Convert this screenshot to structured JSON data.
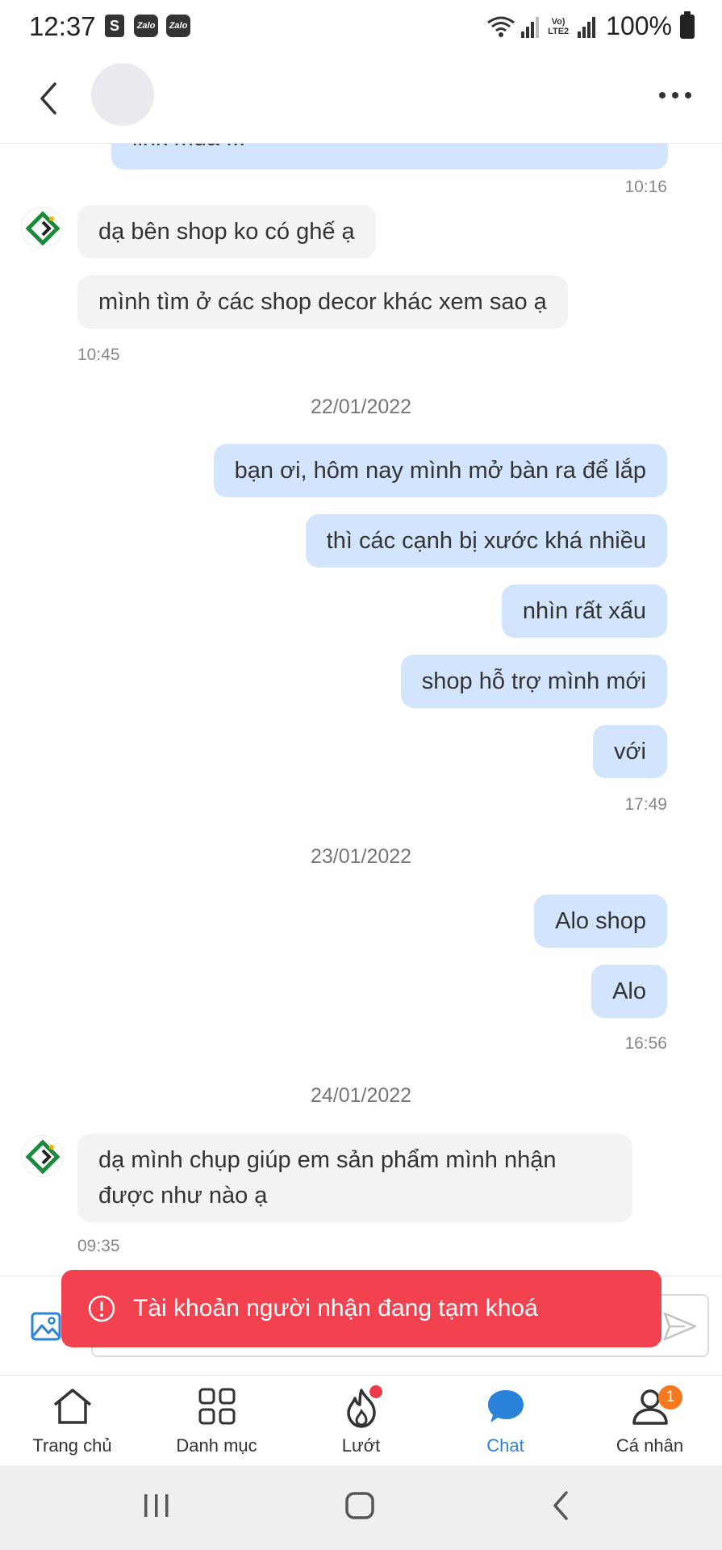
{
  "status_bar": {
    "time": "12:37",
    "notif_shop": "S",
    "notif_zalo_1": "Zalo",
    "notif_zalo_2": "Zalo",
    "volte_1": "Vo)",
    "volte_2": "LTE2",
    "battery": "100%"
  },
  "header": {
    "back_icon": "chevron-left-icon",
    "more_icon": "more-horizontal-icon"
  },
  "messages": {
    "m0_partial": "link mua ... ",
    "m0_time": "10:16",
    "m1": "dạ bên shop ko có ghế ạ",
    "m2": "mình tìm ở các shop decor khác xem sao ạ",
    "m2_time": "10:45",
    "date1": "22/01/2022",
    "m3": "bạn ơi, hôm nay mình mở bàn ra để lắp",
    "m4": "thì các cạnh bị xước khá nhiều",
    "m5": "nhìn rất xấu",
    "m6": "shop hỗ trợ mình mới",
    "m7": "với",
    "m7_time": "17:49",
    "date2": "23/01/2022",
    "m8": "Alo shop",
    "m9": "Alo",
    "m9_time": "16:56",
    "date3": "24/01/2022",
    "m10_line1": "dạ mình chụp giúp em sản phẩm mình nhận",
    "m10_line2": "được như nào ạ",
    "m10_time": "09:35"
  },
  "input": {
    "value": "",
    "placeholder": ""
  },
  "toast": {
    "text": "Tài khoản người nhận đang tạm khoá"
  },
  "nav": {
    "home": "Trang chủ",
    "category": "Danh mục",
    "browse": "Lướt",
    "chat": "Chat",
    "profile": "Cá nhân",
    "profile_badge": "1"
  },
  "colors": {
    "my_bubble": "#d3e5fc",
    "their_bubble": "#f3f3f6",
    "toast_bg": "#f2414f",
    "active_nav": "#2a82d9",
    "badge": "#f47a1f"
  }
}
